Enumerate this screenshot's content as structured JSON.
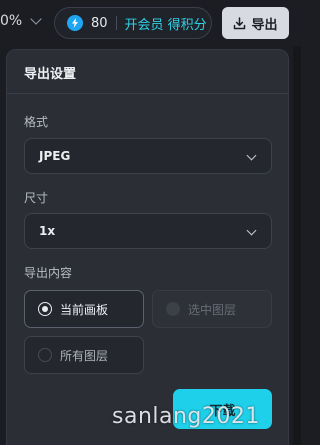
{
  "topbar": {
    "zoom": "0%",
    "points": "80",
    "vip_label": "开会员 得积分",
    "export_label": "导出"
  },
  "panel": {
    "title": "导出设置",
    "format_label": "格式",
    "format_value": "JPEG",
    "size_label": "尺寸",
    "size_value": "1x",
    "content_label": "导出内容",
    "options": {
      "current": "当前画板",
      "selected": "选中图层",
      "all": "所有图层"
    },
    "selected_option": "当前画板",
    "download_label": "下载"
  },
  "watermark": "sanlang2021",
  "colors": {
    "accent": "#1fd0ea",
    "vip_text": "#2fd2e8",
    "coin": "#1ea7f0",
    "panel_bg": "#2b2e35"
  },
  "icons": {
    "coin": "lightning-coin-icon",
    "export": "download-icon",
    "dropdown": "chevron-down-icon"
  }
}
